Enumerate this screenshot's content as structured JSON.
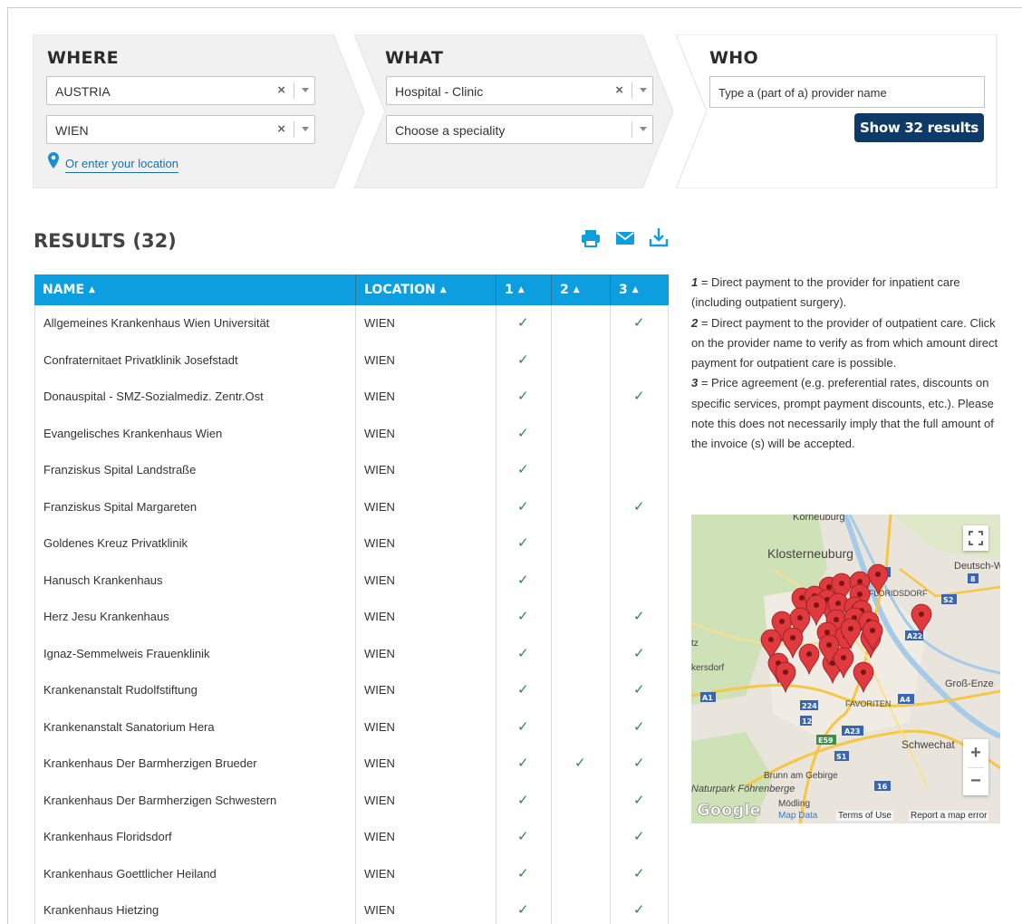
{
  "where": {
    "title": "WHERE",
    "country": "AUSTRIA",
    "city": "WIEN",
    "location_link": "Or enter your location"
  },
  "what": {
    "title": "WHAT",
    "type": "Hospital - Clinic",
    "speciality_placeholder": "Choose a speciality"
  },
  "who": {
    "title": "WHO",
    "placeholder": "Type a (part of a) provider name",
    "button": "Show 32 results"
  },
  "results": {
    "title": "RESULTS (32)",
    "columns": [
      "NAME",
      "LOCATION",
      "1",
      "2",
      "3"
    ],
    "rows": [
      {
        "name": "Allgemeines Krankenhaus Wien Universität",
        "location": "WIEN",
        "c1": "✓",
        "c2": "",
        "c3": "✓"
      },
      {
        "name": "Confraternitaet Privatklinik Josefstadt",
        "location": "WIEN",
        "c1": "✓",
        "c2": "",
        "c3": ""
      },
      {
        "name": "Donauspital - SMZ-Sozialmediz. Zentr.Ost",
        "location": "WIEN",
        "c1": "✓",
        "c2": "",
        "c3": "✓"
      },
      {
        "name": "Evangelisches Krankenhaus Wien",
        "location": "WIEN",
        "c1": "✓",
        "c2": "",
        "c3": ""
      },
      {
        "name": "Franziskus Spital Landstraße",
        "location": "WIEN",
        "c1": "✓",
        "c2": "",
        "c3": ""
      },
      {
        "name": "Franziskus Spital Margareten",
        "location": "WIEN",
        "c1": "✓",
        "c2": "",
        "c3": "✓"
      },
      {
        "name": "Goldenes Kreuz Privatklinik",
        "location": "WIEN",
        "c1": "✓",
        "c2": "",
        "c3": ""
      },
      {
        "name": "Hanusch Krankenhaus",
        "location": "WIEN",
        "c1": "✓",
        "c2": "",
        "c3": ""
      },
      {
        "name": "Herz Jesu Krankenhaus",
        "location": "WIEN",
        "c1": "✓",
        "c2": "",
        "c3": "✓"
      },
      {
        "name": "Ignaz-Semmelweis Frauenklinik",
        "location": "WIEN",
        "c1": "✓",
        "c2": "",
        "c3": "✓"
      },
      {
        "name": "Krankenanstalt Rudolfstiftung",
        "location": "WIEN",
        "c1": "✓",
        "c2": "",
        "c3": "✓"
      },
      {
        "name": "Krankenanstalt Sanatorium Hera",
        "location": "WIEN",
        "c1": "✓",
        "c2": "",
        "c3": "✓"
      },
      {
        "name": "Krankenhaus Der Barmherzigen Brueder",
        "location": "WIEN",
        "c1": "✓",
        "c2": "✓",
        "c3": "✓"
      },
      {
        "name": "Krankenhaus Der Barmherzigen Schwestern",
        "location": "WIEN",
        "c1": "✓",
        "c2": "",
        "c3": "✓"
      },
      {
        "name": "Krankenhaus Floridsdorf",
        "location": "WIEN",
        "c1": "✓",
        "c2": "",
        "c3": "✓"
      },
      {
        "name": "Krankenhaus Goettlicher Heiland",
        "location": "WIEN",
        "c1": "✓",
        "c2": "",
        "c3": "✓"
      },
      {
        "name": "Krankenhaus Hietzing",
        "location": "WIEN",
        "c1": "✓",
        "c2": "",
        "c3": "✓"
      }
    ]
  },
  "legend": {
    "k1": "1",
    "t1": " = Direct payment to the provider for inpatient care (including outpatient surgery).",
    "k2": "2",
    "t2": " = Direct payment to the provider of outpatient care. Click on the provider name to verify as from which amount direct payment for outpatient care is possible.",
    "k3": "3",
    "t3": " = Price agreement (e.g. preferential rates, discounts on specific services, prompt payment discounts, etc.). Please note this does not necessarily imply that the full amount of the invoice (s) will be accepted."
  },
  "map": {
    "labels": [
      "Korneuburg",
      "Klosterneuburg",
      "Deutsch-W",
      "FLORIDSDORF",
      "Groß-Enze",
      "Schwechat",
      "Brunn am Gebirge",
      "Naturpark Föhrenberge",
      "Mödling",
      "tz",
      "kersdorf",
      "FAVORITEN"
    ],
    "roads": [
      "7",
      "8",
      "S2",
      "A22",
      "A1",
      "224",
      "12",
      "A23",
      "A4",
      "E59",
      "S1",
      "16"
    ],
    "logo": "Google",
    "footer": [
      "Map Data",
      "Terms of Use",
      "Report a map error"
    ],
    "zoom_in": "+",
    "zoom_out": "−",
    "colors": {
      "marker": "#e0393e",
      "water": "#a5cbe8",
      "green": "#c9dfb1",
      "road": "#f6c644"
    }
  },
  "colors": {
    "accent": "#0d9ee0",
    "button": "#0e3a68",
    "check": "#2e8b3a",
    "link": "#1a6fb0"
  }
}
